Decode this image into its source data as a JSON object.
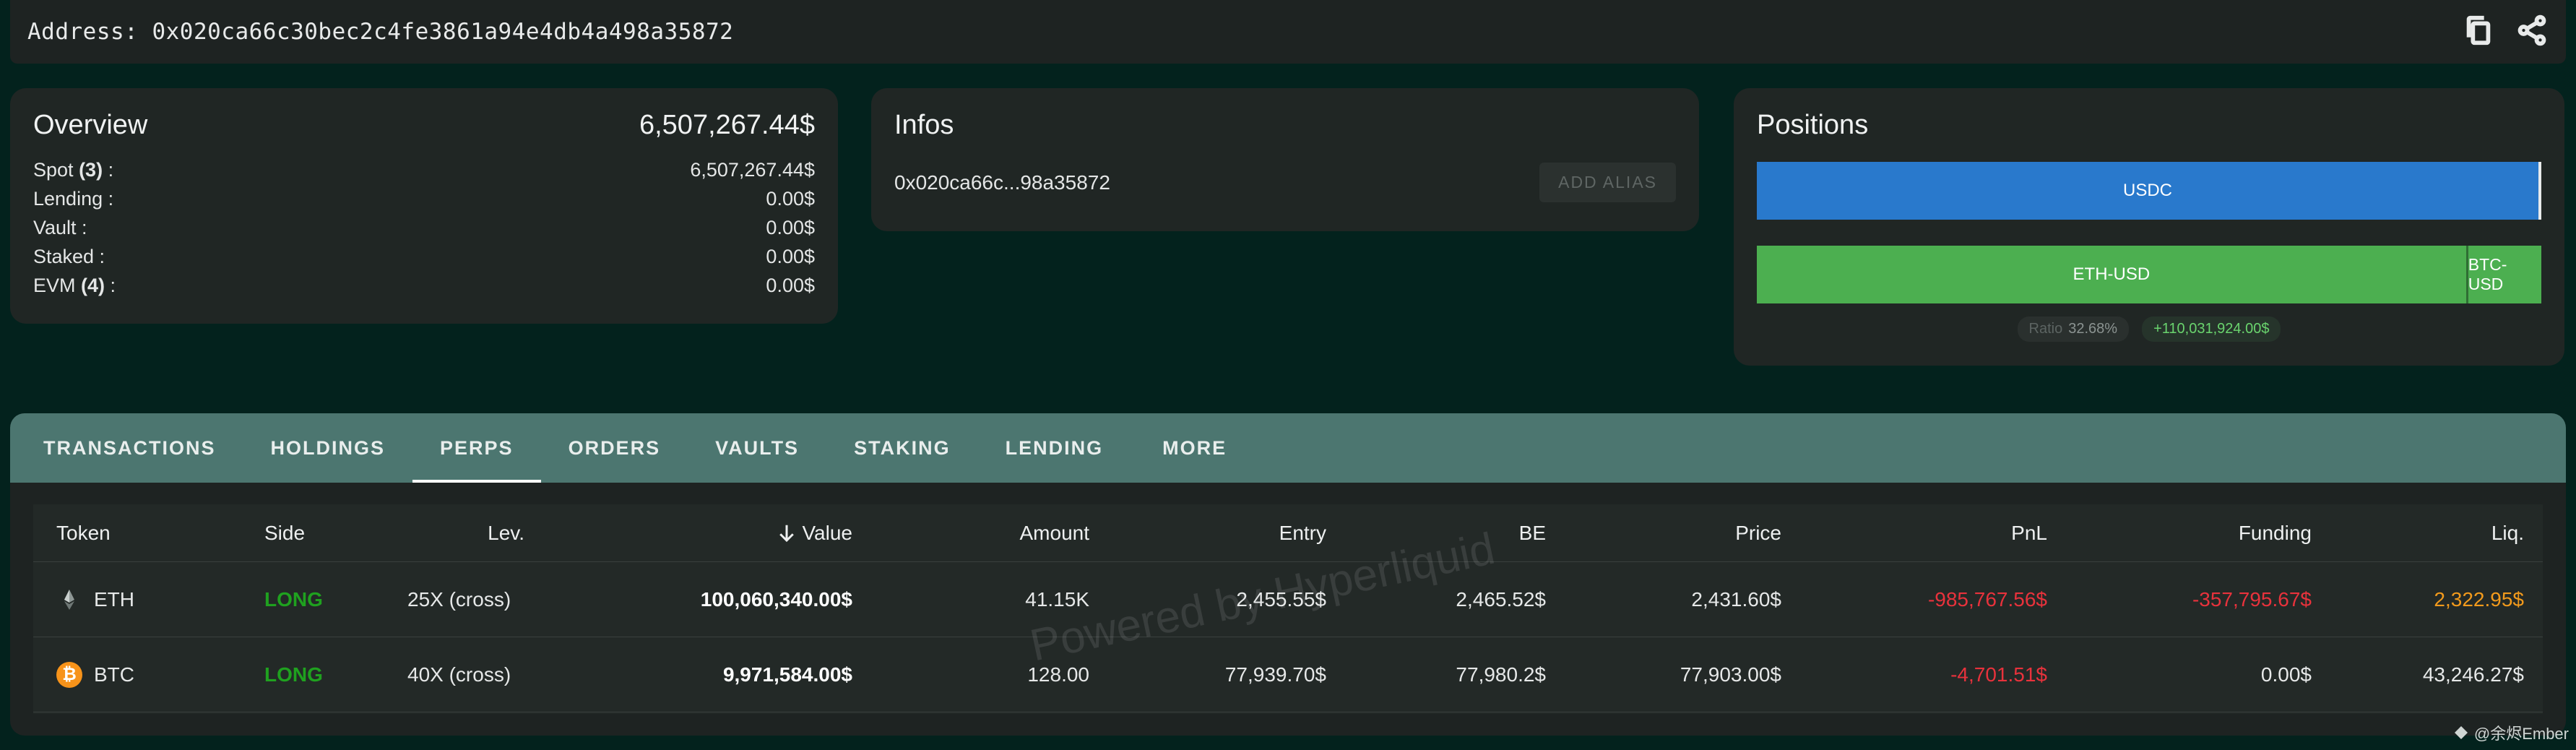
{
  "header": {
    "address_text": "Address: 0x020ca66c30bec2c4fe3861a94e4db4a498a35872",
    "icons": [
      "copy-icon",
      "share-icon"
    ]
  },
  "overview": {
    "title": "Overview",
    "total": "6,507,267.44$",
    "rows": [
      {
        "label": "Spot",
        "count": "(3)",
        "suffix": " :",
        "value": "6,507,267.44$"
      },
      {
        "label": "Lending :",
        "count": "",
        "suffix": "",
        "value": "0.00$"
      },
      {
        "label": "Vault :",
        "count": "",
        "suffix": "",
        "value": "0.00$"
      },
      {
        "label": "Staked :",
        "count": "",
        "suffix": "",
        "value": "0.00$"
      },
      {
        "label": "EVM",
        "count": "(4)",
        "suffix": " :",
        "value": "0.00$"
      }
    ]
  },
  "infos": {
    "title": "Infos",
    "short_address": "0x020ca66c...98a35872",
    "alias_button": "ADD ALIAS"
  },
  "positions": {
    "title": "Positions",
    "bar_usdc": "USDC",
    "bar_eth": "ETH-USD",
    "bar_btc": "BTC-USD",
    "eth_share": 0.904,
    "ratio_label": "Ratio",
    "ratio_value": "32.68%",
    "pnl_chip": "+110,031,924.00$",
    "colors": {
      "usdc": "#2979cc",
      "eth": "#4caf50",
      "btc": "#4caf50"
    }
  },
  "tabs": [
    "TRANSACTIONS",
    "HOLDINGS",
    "PERPS",
    "ORDERS",
    "VAULTS",
    "STAKING",
    "LENDING",
    "MORE"
  ],
  "active_tab": "PERPS",
  "table": {
    "headers": {
      "token": "Token",
      "side": "Side",
      "lev": "Lev.",
      "value": "Value",
      "amount": "Amount",
      "entry": "Entry",
      "be": "BE",
      "price": "Price",
      "pnl": "PnL",
      "funding": "Funding",
      "liq": "Liq."
    },
    "rows": [
      {
        "token": "ETH",
        "side": "LONG",
        "lev": "25X (cross)",
        "value": "100,060,340.00$",
        "amount": "41.15K",
        "entry": "2,455.55$",
        "be": "2,465.52$",
        "price": "2,431.60$",
        "pnl": "-985,767.56$",
        "funding": "-357,795.67$",
        "liq": "2,322.95$"
      },
      {
        "token": "BTC",
        "side": "LONG",
        "lev": "40X (cross)",
        "value": "9,971,584.00$",
        "amount": "128.00",
        "entry": "77,939.70$",
        "be": "77,980.2$",
        "price": "77,903.00$",
        "pnl": "-4,701.51$",
        "funding": "0.00$",
        "liq": "43,246.27$"
      }
    ]
  },
  "watermark": "Powered by Hyperliquid",
  "credit": "@余烬Ember"
}
